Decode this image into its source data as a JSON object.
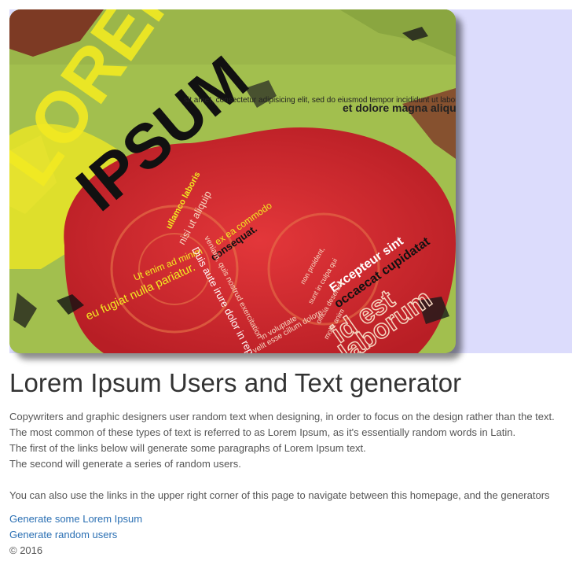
{
  "hero": {
    "headline_top": "LOREM",
    "headline_main": "IPSUM",
    "words": [
      "sit amet, consectetur adipisicing elit, sed do eiusmod tempor incididunt ut labore",
      "et dolore magna aliqua",
      "ullamco laboris",
      "nisi ut aliquip",
      "ex ea commodo",
      "consequat.",
      "Ut enim ad minim",
      "veniam, quis nostrud exercitation",
      "Duis aute irure dolor in reprehenderit",
      "eu fugiat nulla pariatur.",
      "in voluptate",
      "velit esse cillum dolore",
      "Excepteur sint",
      "occaecat cupidatat",
      "non proident,",
      "sunt in culpa qui",
      "officia deserunt",
      "mollit anim",
      "id est",
      "laborum"
    ]
  },
  "page": {
    "title": "Lorem Ipsum Users and Text generator",
    "paragraphs": [
      "Copywriters and graphic designers user random text when designing, in order to focus on the design rather than the text.",
      "The most common of these types of text is referred to as Lorem Ipsum, as it's essentially random words in Latin.",
      "The first of the links below will generate some paragraphs of Lorem Ipsum text.",
      "The second will generate a series of random users."
    ],
    "navigation_note": "You can also use the links in the upper right corner of this page to navigate between this homepage, and the generators"
  },
  "links": {
    "lorem": "Generate some Lorem Ipsum",
    "users": "Generate random users"
  },
  "footer": {
    "copyright": "© 2016"
  },
  "colors": {
    "link": "#2a6fb3",
    "hero_band": "#dcdcfc",
    "hero_green": "#a2bf4e",
    "hero_red": "#d42a2f",
    "hero_yellow": "#f2ea22"
  }
}
